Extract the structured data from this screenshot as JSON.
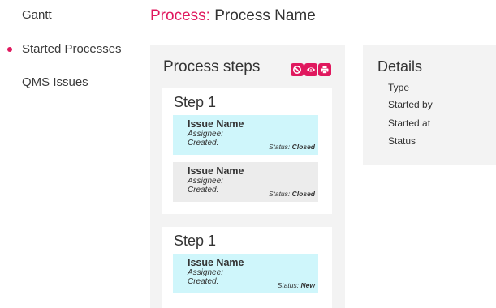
{
  "sidebar": {
    "items": [
      {
        "label": "Gantt",
        "active": false
      },
      {
        "label": "Started Processes",
        "active": true
      },
      {
        "label": "QMS Issues",
        "active": false
      }
    ]
  },
  "header": {
    "title_prefix": "Process:",
    "title_name": "Process Name"
  },
  "colors": {
    "accent": "#e0185e",
    "issue_highlight": "#cff6fb",
    "issue_grey": "#ececec",
    "panel_bg": "#f3f3f3"
  },
  "process_steps": {
    "heading": "Process steps",
    "actions": [
      {
        "icon": "block-icon"
      },
      {
        "icon": "eye-icon"
      },
      {
        "icon": "printer-icon"
      }
    ],
    "steps": [
      {
        "title": "Step 1",
        "issues": [
          {
            "name": "Issue Name",
            "assignee_label": "Assignee:",
            "created_label": "Created:",
            "status_label": "Status:",
            "status": "Closed"
          },
          {
            "name": "Issue Name",
            "assignee_label": "Assignee:",
            "created_label": "Created:",
            "status_label": "Status:",
            "status": "Closed"
          }
        ]
      },
      {
        "title": "Step 1",
        "issues": [
          {
            "name": "Issue Name",
            "assignee_label": "Assignee:",
            "created_label": "Created:",
            "status_label": "Status:",
            "status": "New"
          }
        ]
      }
    ]
  },
  "details": {
    "heading": "Details",
    "fields": [
      "Type",
      "Started by",
      "Started at",
      "Status"
    ]
  }
}
